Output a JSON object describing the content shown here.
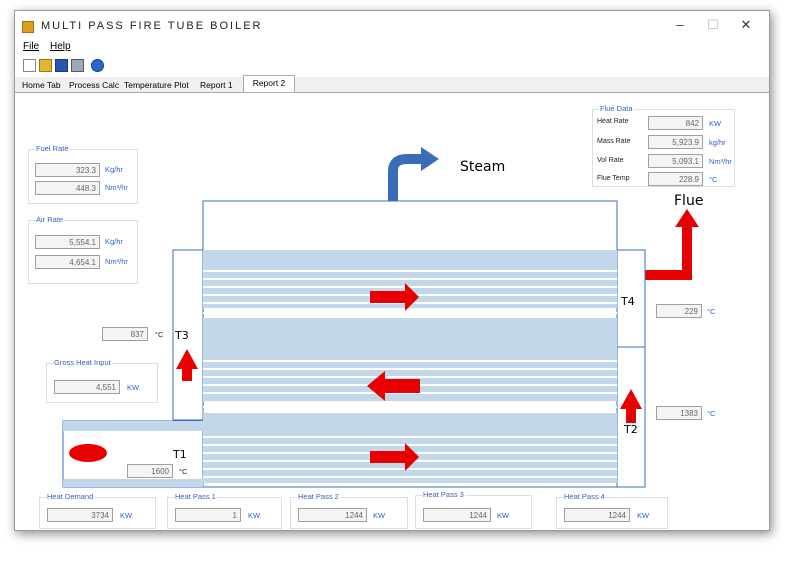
{
  "window": {
    "title": "MULTI PASS FIRE TUBE BOILER",
    "controls": {
      "minimize": "–",
      "maximize": "☐",
      "close": "✕"
    }
  },
  "menu": {
    "file": "File",
    "help": "Help"
  },
  "toolbar": {
    "icons": [
      "new-icon",
      "open-icon",
      "save-icon",
      "print-icon",
      "help-icon"
    ]
  },
  "tabs": [
    "Home Tab",
    "Process Calc",
    "Temperature Plot",
    "Report 1",
    "Report 2"
  ],
  "active_tab": "Report 2",
  "fuel_rate": {
    "label": "Fuel Rate",
    "mass": "323.3",
    "mass_unit": "Kg/hr",
    "vol": "448.3",
    "vol_unit": "Nm³/hr"
  },
  "air_rate": {
    "label": "Air Rate",
    "mass": "5,554.1",
    "mass_unit": "Kg/hr",
    "vol": "4,654.1",
    "vol_unit": "Nm³/hr"
  },
  "flue_data": {
    "label": "Flue Data",
    "rows": [
      {
        "name": "Heat Rate",
        "value": "842",
        "unit": "KW"
      },
      {
        "name": "Mass Rate",
        "value": "5,923.9",
        "unit": "kg/hr"
      },
      {
        "name": "Vol Rate",
        "value": "5,093.1",
        "unit": "Nm³/hr"
      },
      {
        "name": "Flue Temp",
        "value": "228.9",
        "unit": "°C"
      }
    ]
  },
  "gross_heat_input": {
    "label": "Gross Heat Input",
    "value": "4,551",
    "unit": "KW"
  },
  "diagram": {
    "steam_label": "Steam",
    "flue_label": "Flue",
    "t1": {
      "label": "T1",
      "value": "1600",
      "unit": "°C"
    },
    "t2": {
      "label": "T2",
      "value": "1383",
      "unit": "°C"
    },
    "t3": {
      "label": "T3",
      "value": "837",
      "unit": "°C"
    },
    "t4": {
      "label": "T4",
      "value": "229",
      "unit": "°C"
    }
  },
  "bottom": [
    {
      "label": "Heat Demand",
      "value": "3734",
      "unit": "KW"
    },
    {
      "label": "Heat Pass 1",
      "value": "1",
      "unit": "KW"
    },
    {
      "label": "Heat Pass 2",
      "value": "1244",
      "unit": "KW"
    },
    {
      "label": "Heat Pass 3",
      "value": "1244",
      "unit": "KW"
    },
    {
      "label": "Heat Pass 4",
      "value": "1244",
      "unit": "KW"
    }
  ],
  "colors": {
    "accent_blue": "#2f5fcf",
    "tube_blue": "#c2d8ea",
    "arrow_red": "#e80000",
    "steam_blue": "#3a6db8"
  }
}
